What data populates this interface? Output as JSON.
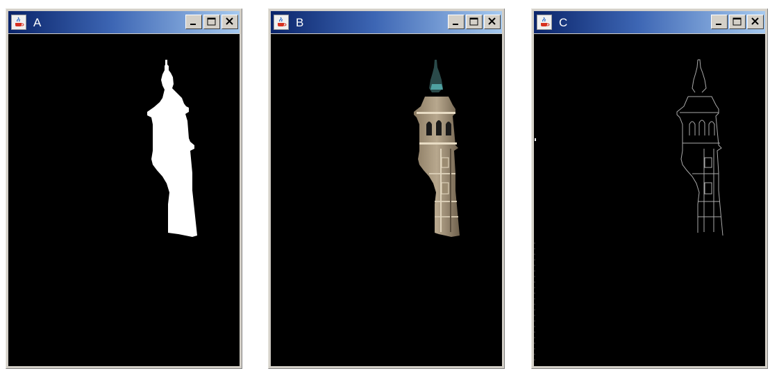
{
  "windows": [
    {
      "title": "A"
    },
    {
      "title": "B"
    },
    {
      "title": "C"
    }
  ],
  "icons": {
    "app": "java-coffee-cup-icon",
    "minimize": "minimize-icon",
    "maximize": "maximize-icon",
    "close": "close-icon"
  },
  "colors": {
    "titlebar_start": "#0a246a",
    "titlebar_end": "#a6caf0",
    "canvas_bg": "#000000"
  }
}
